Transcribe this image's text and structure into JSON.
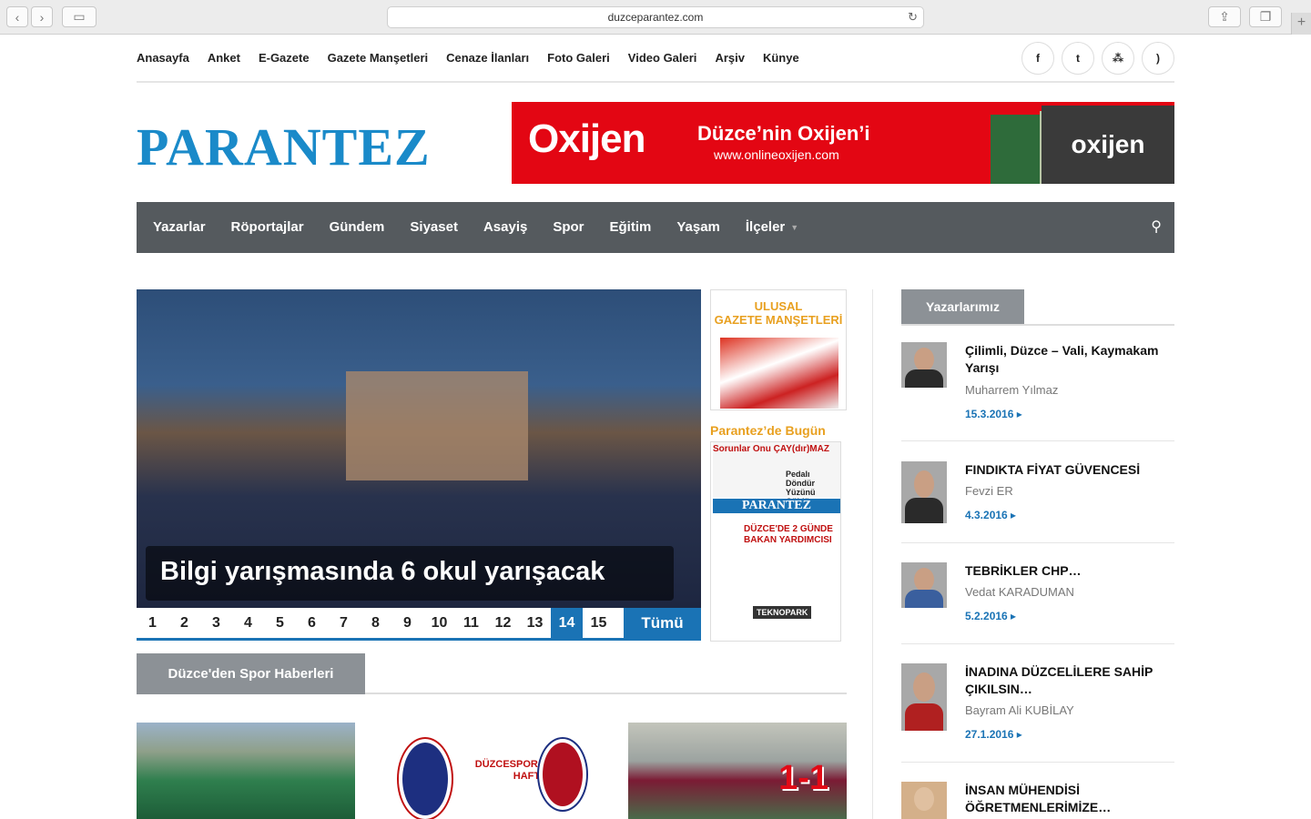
{
  "browser": {
    "url": "duzceparantez.com"
  },
  "topnav": {
    "links": [
      "Anasayfa",
      "Anket",
      "E-Gazete",
      "Gazete Manşetleri",
      "Cenaze İlanları",
      "Foto Galeri",
      "Video Galeri",
      "Arşiv",
      "Künye"
    ]
  },
  "social": {
    "facebook": "f",
    "twitter": "t",
    "sitemap": "⁂",
    "rss": ")"
  },
  "site": {
    "logo": "PARANTEZ"
  },
  "ad": {
    "brand": "Oxijen",
    "headline": "Düzce’nin Oxijen’i",
    "url": "www.onlineoxijen.com",
    "cover_text": "oxijen"
  },
  "mainnav": {
    "items": [
      "Yazarlar",
      "Röportajlar",
      "Gündem",
      "Siyaset",
      "Asayiş",
      "Spor",
      "Eğitim",
      "Yaşam",
      "İlçeler"
    ]
  },
  "slider": {
    "caption": "Bilgi yarışmasında 6 okul yarışacak",
    "pages": [
      "1",
      "2",
      "3",
      "4",
      "5",
      "6",
      "7",
      "8",
      "9",
      "10",
      "11",
      "12",
      "13",
      "14",
      "15"
    ],
    "active_page": "14",
    "all_label": "Tümü"
  },
  "gazete": {
    "line1": "ULUSAL",
    "line2": "GAZETE MANŞETLERİ"
  },
  "paper": {
    "title": "Parantez’de Bugün",
    "headline1": "Sorunlar Onu ÇAY(dır)MAZ",
    "headline2": "Pedalı Döndür Yüzünü Güldür",
    "logo": "PARANTEZ",
    "big": "DÜZCE'DE 2 GÜNDE BAKAN YARDIMCISI",
    "foot": "TEKNOPARK"
  },
  "sports": {
    "section_title": "Düzce'den Spor Haberleri",
    "thumb2_text": "DÜZCESPOR İÇİN ZOR HAFTA",
    "thumb3_text": "1-1"
  },
  "sidebar": {
    "title": "Yazarlarımız",
    "authors": [
      {
        "title": "Çilimli, Düzce – Vali, Kaymakam Yarışı",
        "name": "Muharrem Yılmaz",
        "date": "15.3.2016 ▸"
      },
      {
        "title": "FINDIKTA FİYAT GÜVENCESİ",
        "name": "Fevzi ER",
        "date": "4.3.2016 ▸"
      },
      {
        "title": "TEBRİKLER CHP…",
        "name": "Vedat KARADUMAN",
        "date": "5.2.2016 ▸"
      },
      {
        "title": "İNADINA DÜZCELİLERE SAHİP ÇIKILSIN…",
        "name": "Bayram Ali KUBİLAY",
        "date": "27.1.2016 ▸"
      },
      {
        "title": "İNSAN MÜHENDİSİ ÖĞRETMENLERİMİZE…",
        "name": "",
        "date": ""
      }
    ]
  }
}
